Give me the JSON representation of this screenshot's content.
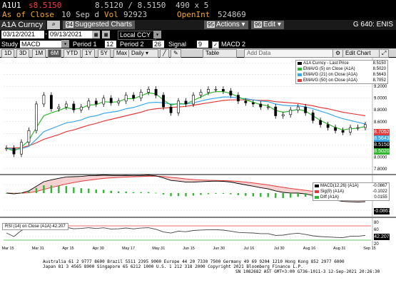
{
  "quote": {
    "ticker": "A1U1",
    "price": "s8.5150",
    "bid_ask": "8.5120 / 8.5150",
    "size": "490 x 5",
    "as_of_label": "As of Close",
    "date": "10 Sep d",
    "vol_label": "Vol",
    "vol_value": "92923",
    "openint_label": "OpenInt",
    "openint_value": "524869"
  },
  "titlebar": {
    "title": "A1A Curncy",
    "suggested_num": "94",
    "suggested_label": "Suggested Charts",
    "actions_num": "95",
    "actions_label": "Actions",
    "edit_num": "96",
    "edit_label": "Edit",
    "right_tag": "G 640: ENIS"
  },
  "range": {
    "start": "03/12/2021",
    "end": "09/13/2021",
    "currency": "Local CCY"
  },
  "study": {
    "study_label": "Study",
    "study_value": "MACD",
    "period1_label": "Period 1",
    "period1_value": "12",
    "period2_label": "Period 2",
    "period2_value": "26",
    "signal_label": "Signal",
    "signal_value": "9",
    "macd2_label": "MACD 2"
  },
  "toolbar": {
    "periods": [
      "1D",
      "3D",
      "1M",
      "6M",
      "YTD",
      "1Y",
      "5Y",
      "Max"
    ],
    "selected_period": "6M",
    "freq": "Daily",
    "table_label": "Table",
    "adddata_label": "Add Data",
    "editchart_label": "Edit Chart"
  },
  "colors": {
    "price": "#000000",
    "emavg5": "#2fb82f",
    "emavg21": "#3aa8e8",
    "emavg50": "#e23b3b",
    "accent": "#f5a623",
    "price_text": "#ff3b3b"
  },
  "chart_data": {
    "type": "line",
    "x_ticks": [
      "Mar 15",
      "Mar 31",
      "Apr 15",
      "Apr 30",
      "May 17",
      "May 31",
      "Jun 15",
      "Jun 30",
      "Jul 16",
      "Jul 30",
      "Aug 16",
      "Aug 31",
      "Sep 15"
    ],
    "x_year_label": "2021",
    "y_ticks_price": [
      "9.6000",
      "9.4000",
      "9.2000",
      "9.0000",
      "8.8000",
      "8.6000",
      "8.4000",
      "8.2000",
      "8.0000",
      "7.8000"
    ],
    "ylim_price": [
      7.75,
      9.65
    ],
    "series": [
      {
        "name": "A1A Curncy - Last Price",
        "last": "8.5150",
        "values": [
          8.15,
          8.05,
          8.25,
          8.45,
          8.9,
          9.05,
          8.82,
          8.85,
          8.9,
          8.8,
          8.85,
          8.95,
          8.9,
          9.0,
          8.92,
          8.95,
          9.05,
          9.0,
          9.1,
          9.15,
          9.05,
          8.85,
          8.75,
          8.95,
          8.9,
          9.05,
          9.1,
          9.15,
          9.15,
          9.12,
          9.05,
          8.95,
          8.92,
          8.9,
          8.85,
          8.85,
          8.7,
          8.72,
          8.8,
          8.85,
          8.75,
          8.62,
          8.55,
          8.5,
          8.45,
          8.42,
          8.5,
          8.5,
          8.55
        ]
      },
      {
        "name": "EMAVG (5) on Close (A1A)",
        "last": "8.5020",
        "values": [
          8.15,
          8.1,
          8.17,
          8.28,
          8.5,
          8.7,
          8.75,
          8.79,
          8.84,
          8.81,
          8.83,
          8.88,
          8.89,
          8.94,
          8.93,
          8.94,
          8.99,
          8.99,
          9.04,
          9.09,
          9.07,
          8.97,
          8.88,
          8.91,
          8.9,
          8.96,
          9.02,
          9.08,
          9.11,
          9.11,
          9.08,
          9.02,
          8.97,
          8.93,
          8.89,
          8.87,
          8.79,
          8.76,
          8.78,
          8.81,
          8.78,
          8.7,
          8.62,
          8.56,
          8.5,
          8.46,
          8.48,
          8.49,
          8.52
        ]
      },
      {
        "name": "EMAVG (21) on Close (A1A)",
        "last": "8.5643",
        "values": [
          8.15,
          8.13,
          8.14,
          8.18,
          8.3,
          8.43,
          8.48,
          8.53,
          8.58,
          8.6,
          8.63,
          8.68,
          8.7,
          8.74,
          8.76,
          8.78,
          8.82,
          8.84,
          8.88,
          8.92,
          8.93,
          8.92,
          8.9,
          8.9,
          8.9,
          8.92,
          8.95,
          8.98,
          9.0,
          9.02,
          9.02,
          9.0,
          8.99,
          8.97,
          8.95,
          8.94,
          8.9,
          8.88,
          8.87,
          8.87,
          8.85,
          8.82,
          8.78,
          8.74,
          8.69,
          8.65,
          8.62,
          8.59,
          8.56
        ]
      },
      {
        "name": "EMAVG (50) on Close (A1A)",
        "last": "8.7052",
        "values": [
          8.15,
          8.15,
          8.16,
          8.19,
          8.24,
          8.3,
          8.34,
          8.38,
          8.43,
          8.46,
          8.5,
          8.54,
          8.57,
          8.61,
          8.64,
          8.67,
          8.7,
          8.73,
          8.76,
          8.8,
          8.82,
          8.83,
          8.84,
          8.85,
          8.86,
          8.88,
          8.9,
          8.92,
          8.94,
          8.96,
          8.97,
          8.97,
          8.97,
          8.97,
          8.96,
          8.96,
          8.94,
          8.93,
          8.92,
          8.91,
          8.89,
          8.87,
          8.84,
          8.82,
          8.79,
          8.76,
          8.74,
          8.72,
          8.7
        ]
      }
    ],
    "macd": {
      "legend": [
        {
          "name": "MACD(12,26) (A1A)",
          "last": "-0.0867"
        },
        {
          "name": "Sig(9) (A1A)",
          "last": "-0.1022"
        },
        {
          "name": "Diff (A1A)",
          "last": "0.0155"
        }
      ],
      "y_ticks": [
        "0.0000",
        "-0.0500",
        "-0.1000"
      ],
      "price_tag": "-0.0867"
    },
    "rsi": {
      "legend": "RSI (14) on Close (A1A) 42.207",
      "y_ticks": [
        "80",
        "60",
        "40",
        "20"
      ],
      "price_tag": "42.207"
    },
    "price_tags": [
      "8.7052",
      "8.5643",
      "8.5150",
      "8.5020"
    ]
  },
  "footer": {
    "line1": "Australia 61 2 9777 8600 Brazil 5511 2395 9000 Europe 44 20 7330 7500 Germany 49 69 9204 1210 Hong Kong 852 2977 6000",
    "line2": "Japan 81 3 4565 8900      Singapore 65 6212 1000      U.S. 1 212 318 2000      Copyright 2021 Bloomberg Finance L.P.",
    "line3": "SN 1082682 AST  GMT+3:00 G736-1011-3 12-Sep-2021 20:26:30"
  }
}
